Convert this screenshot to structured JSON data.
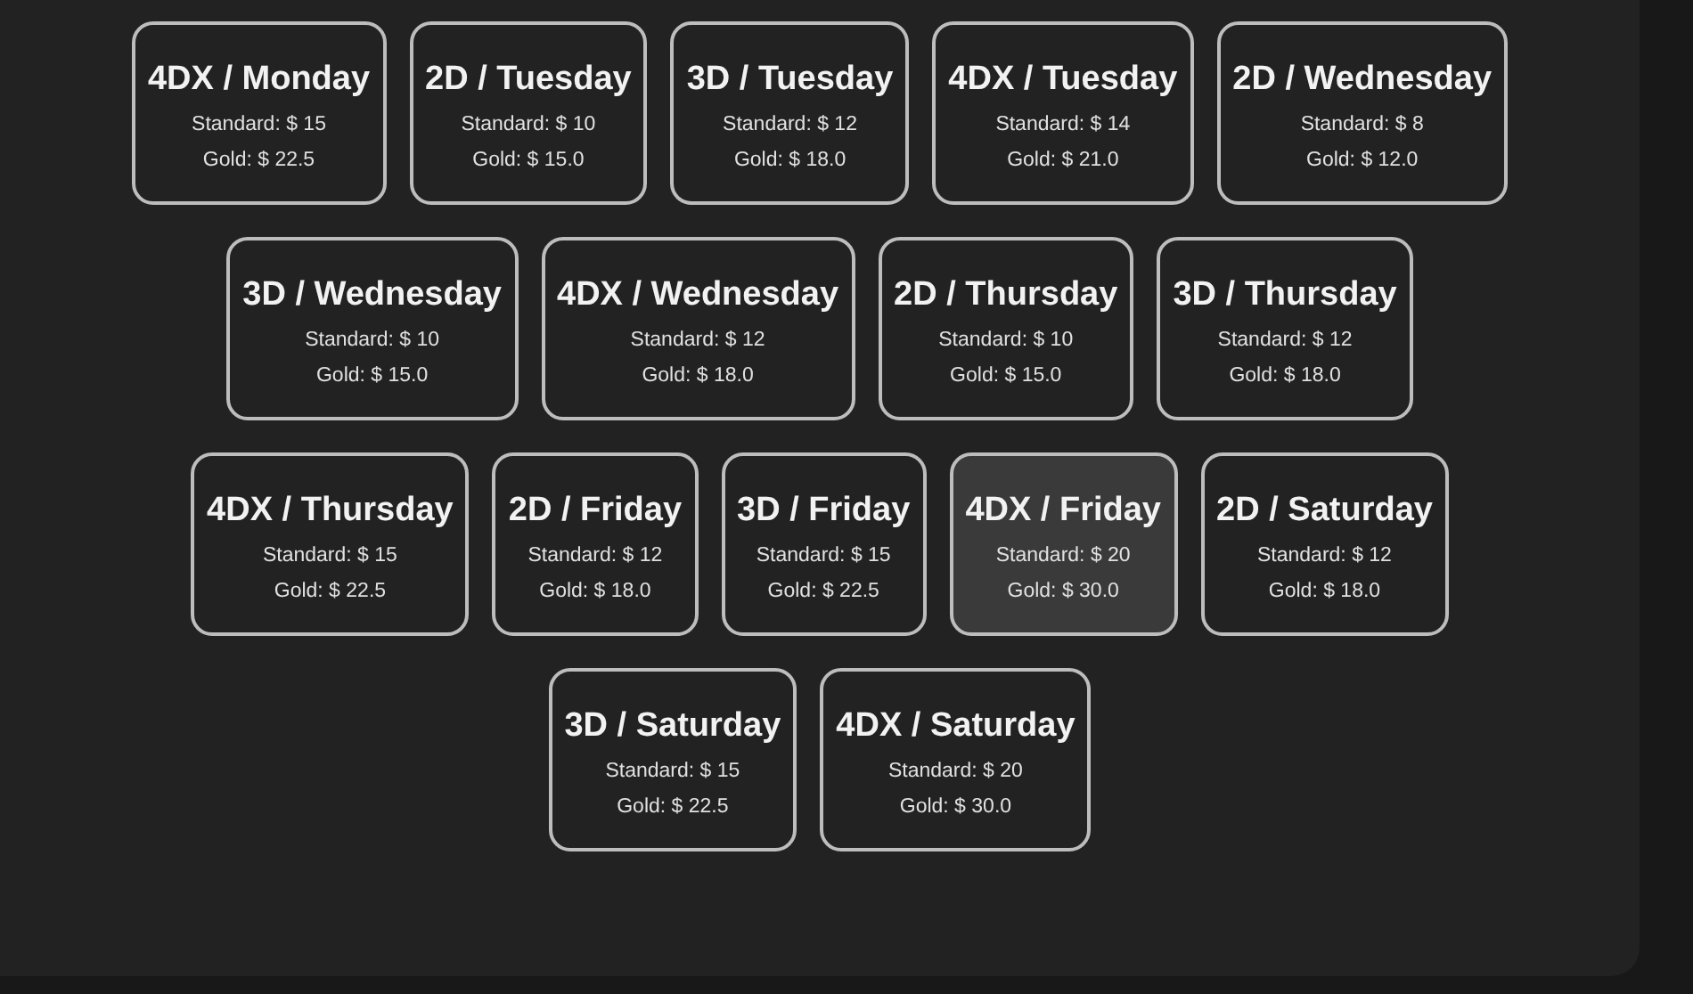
{
  "rows": [
    {
      "cards": [
        {
          "title": "4DX / Monday",
          "standard": "Standard: $ 15",
          "gold": "Gold: $ 22.5",
          "hovered": false
        },
        {
          "title": "2D / Tuesday",
          "standard": "Standard: $ 10",
          "gold": "Gold: $ 15.0",
          "hovered": false
        },
        {
          "title": "3D / Tuesday",
          "standard": "Standard: $ 12",
          "gold": "Gold: $ 18.0",
          "hovered": false
        },
        {
          "title": "4DX / Tuesday",
          "standard": "Standard: $ 14",
          "gold": "Gold: $ 21.0",
          "hovered": false
        },
        {
          "title": "2D / Wednesday",
          "standard": "Standard: $ 8",
          "gold": "Gold: $ 12.0",
          "hovered": false
        }
      ]
    },
    {
      "cards": [
        {
          "title": "3D / Wednesday",
          "standard": "Standard: $ 10",
          "gold": "Gold: $ 15.0",
          "hovered": false
        },
        {
          "title": "4DX / Wednesday",
          "standard": "Standard: $ 12",
          "gold": "Gold: $ 18.0",
          "hovered": false
        },
        {
          "title": "2D / Thursday",
          "standard": "Standard: $ 10",
          "gold": "Gold: $ 15.0",
          "hovered": false
        },
        {
          "title": "3D / Thursday",
          "standard": "Standard: $ 12",
          "gold": "Gold: $ 18.0",
          "hovered": false
        }
      ]
    },
    {
      "cards": [
        {
          "title": "4DX / Thursday",
          "standard": "Standard: $ 15",
          "gold": "Gold: $ 22.5",
          "hovered": false
        },
        {
          "title": "2D / Friday",
          "standard": "Standard: $ 12",
          "gold": "Gold: $ 18.0",
          "hovered": false
        },
        {
          "title": "3D / Friday",
          "standard": "Standard: $ 15",
          "gold": "Gold: $ 22.5",
          "hovered": false
        },
        {
          "title": "4DX / Friday",
          "standard": "Standard: $ 20",
          "gold": "Gold: $ 30.0",
          "hovered": true
        },
        {
          "title": "2D / Saturday",
          "standard": "Standard: $ 12",
          "gold": "Gold: $ 18.0",
          "hovered": false
        }
      ]
    },
    {
      "cards": [
        {
          "title": "3D / Saturday",
          "standard": "Standard: $ 15",
          "gold": "Gold: $ 22.5",
          "hovered": false
        },
        {
          "title": "4DX / Saturday",
          "standard": "Standard: $ 20",
          "gold": "Gold: $ 30.0",
          "hovered": false
        }
      ]
    }
  ]
}
